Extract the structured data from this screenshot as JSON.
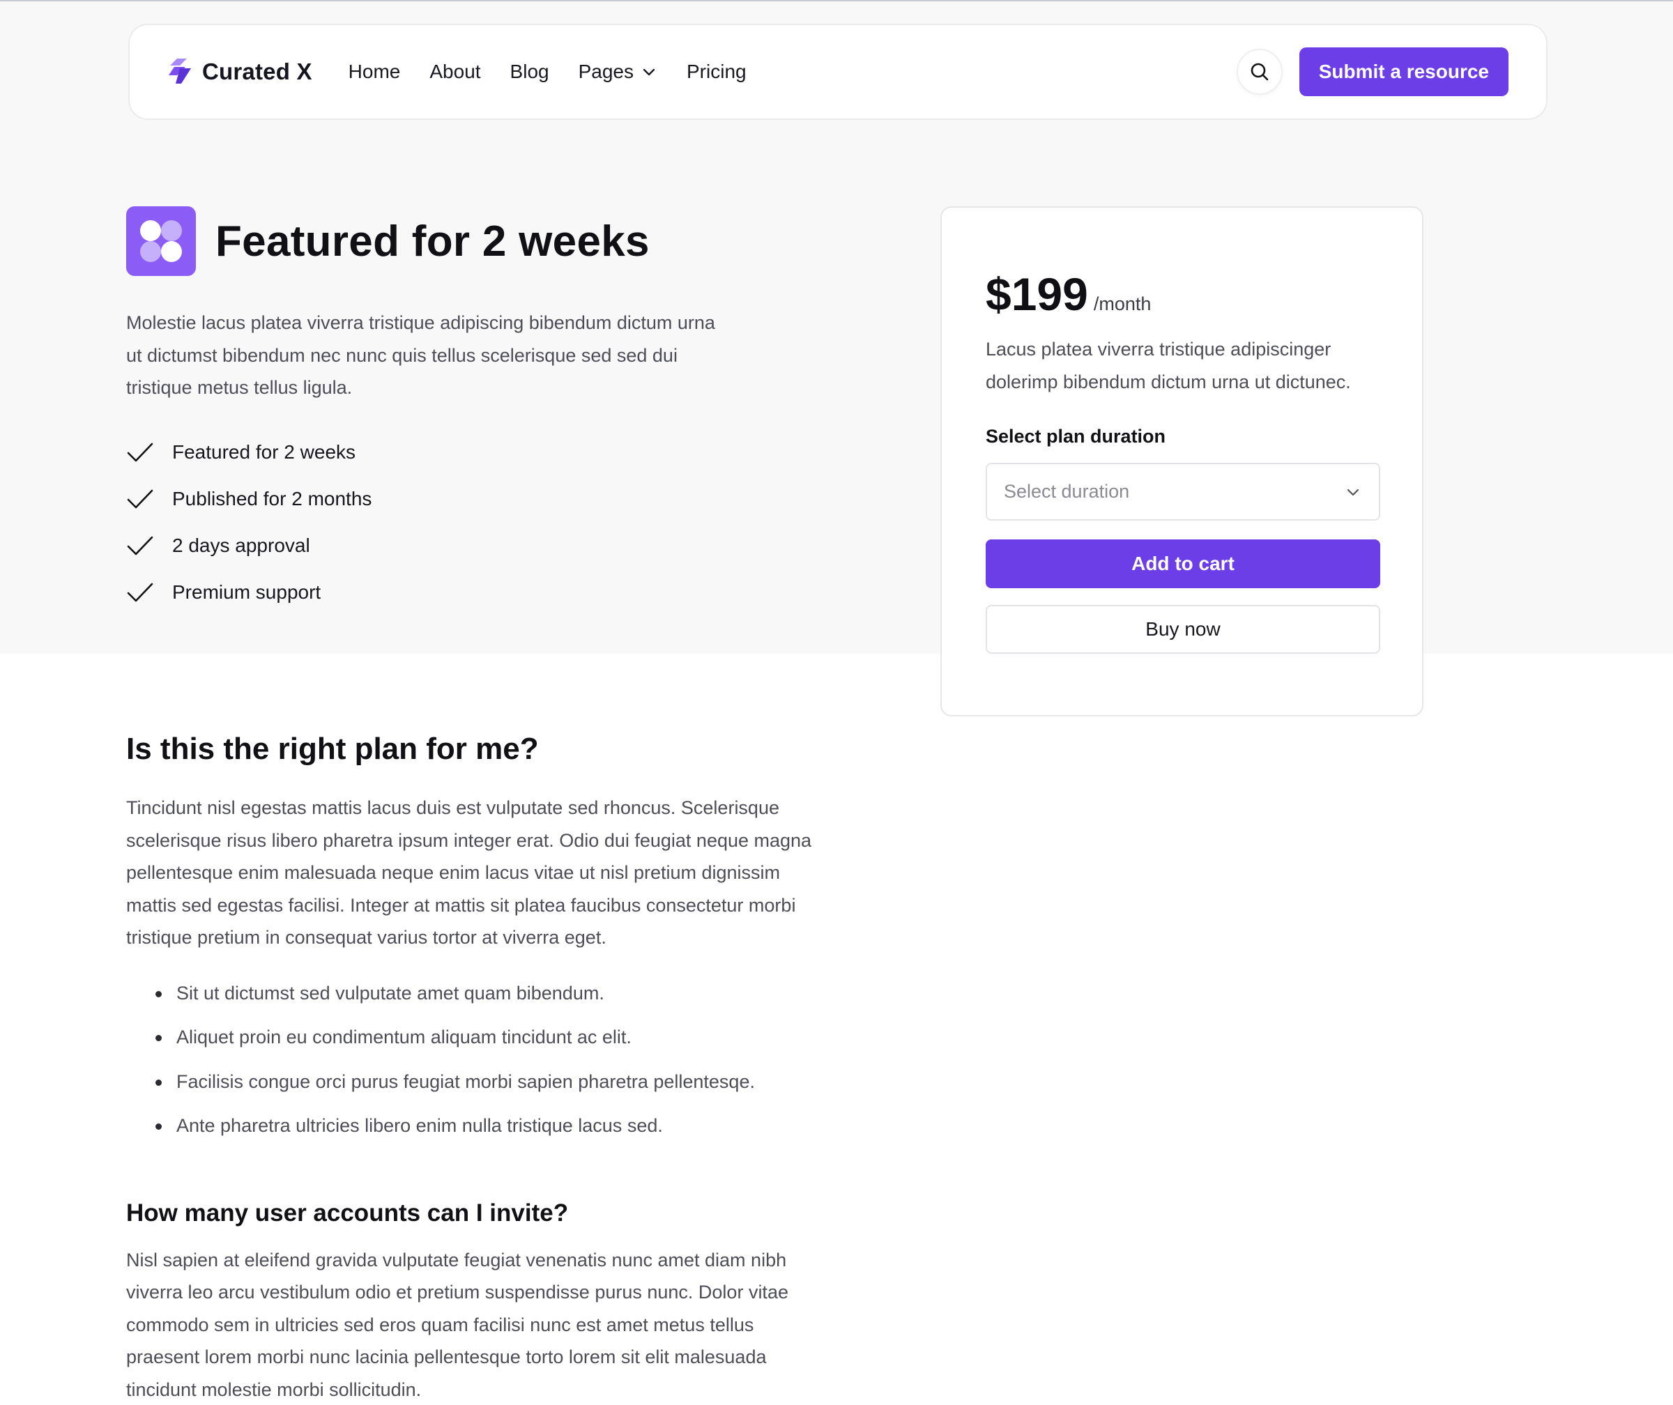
{
  "nav": {
    "brand": "Curated X",
    "links": [
      {
        "label": "Home"
      },
      {
        "label": "About"
      },
      {
        "label": "Blog"
      },
      {
        "label": "Pages"
      },
      {
        "label": "Pricing"
      }
    ],
    "submit_label": "Submit a resource"
  },
  "hero": {
    "title": "Featured for 2 weeks",
    "description": "Molestie lacus platea viverra tristique adipiscing bibendum dictum urna ut dictumst bibendum nec nunc quis tellus scelerisque sed sed dui tristique metus tellus ligula.",
    "features": [
      "Featured for 2 weeks",
      "Published for 2 months",
      "2 days approval",
      "Premium support"
    ]
  },
  "pricing": {
    "price": "$199",
    "period": "/month",
    "description": "Lacus platea viverra tristique adipiscinger dolerimp bibendum dictum urna ut dictunec.",
    "select_label": "Select plan duration",
    "select_placeholder": "Select duration",
    "add_to_cart": "Add to cart",
    "buy_now": "Buy now"
  },
  "faq": {
    "q1_title": "Is this the right plan for me?",
    "q1_text": "Tincidunt nisl egestas mattis lacus duis est vulputate sed rhoncus. Scelerisque scelerisque risus libero pharetra ipsum integer erat. Odio dui feugiat neque magna pellentesque enim malesuada neque enim lacus vitae ut nisl pretium dignissim mattis sed egestas facilisi. Integer at mattis sit platea faucibus consectetur morbi tristique pretium in consequat varius tortor at viverra eget.",
    "bullets": [
      "Sit ut dictumst sed vulputate amet quam bibendum.",
      "Aliquet proin eu condimentum aliquam tincidunt ac elit.",
      "Facilisis congue orci purus feugiat morbi sapien pharetra pellentesqe.",
      "Ante pharetra ultricies libero enim nulla tristique lacus sed."
    ],
    "q2_title": "How many user accounts can I invite?",
    "q2_text": "Nisl sapien at eleifend gravida vulputate feugiat venenatis nunc amet diam nibh viverra leo arcu vestibulum odio et pretium suspendisse purus nunc. Dolor vitae commodo sem in ultricies sed eros quam facilisi nunc est amet metus tellus praesent lorem morbi nunc lacinia pellentesque torto lorem sit elit malesuada tincidunt molestie morbi sollicitudin."
  },
  "icons": {
    "brand_logo": "curated-x-logo-icon",
    "search": "search-icon",
    "dropdown": "chevron-down-icon",
    "check": "check-icon",
    "hero": "four-dots-icon"
  },
  "colors": {
    "accent": "#6c3ee8",
    "hero_icon": "#8b5cf6",
    "band_background": "#f8f8f9"
  }
}
